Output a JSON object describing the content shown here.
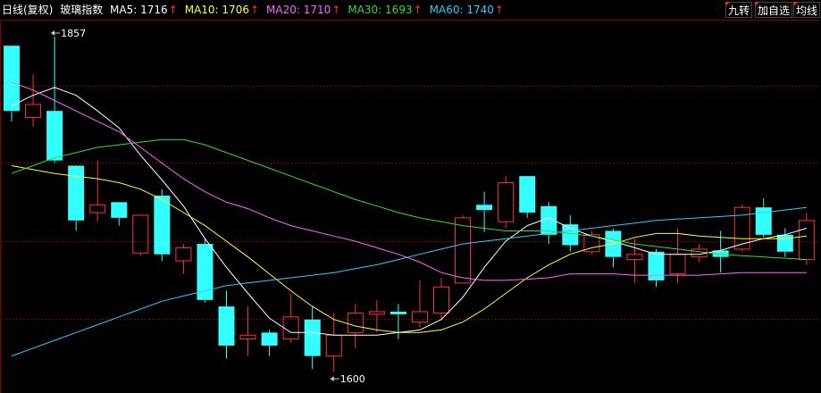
{
  "header": {
    "period": "日线(复权)",
    "name": "玻璃指数",
    "ma": [
      {
        "label": "MA5:",
        "value": "1716",
        "color": "#ffffff"
      },
      {
        "label": "MA10:",
        "value": "1706",
        "color": "#ffff33"
      },
      {
        "label": "MA20:",
        "value": "1710",
        "color": "#ff66ff"
      },
      {
        "label": "MA30:",
        "value": "1693",
        "color": "#33dd33"
      },
      {
        "label": "MA60:",
        "value": "1740",
        "color": "#33ccff"
      }
    ],
    "arrow": "↑"
  },
  "buttons": {
    "nine": "九转",
    "watch": "加自选",
    "avg": "均线"
  },
  "colors": {
    "up": "#ff3030",
    "down": "#33ffff",
    "grid": "#800000",
    "bg": "#000000"
  },
  "chart_data": {
    "type": "candlestick",
    "ylim": [
      1585,
      1870
    ],
    "annotations": {
      "high_label": "1857",
      "low_label": "1600"
    },
    "candles": [
      {
        "o": 1850,
        "c": 1800,
        "h": 1850,
        "l": 1792
      },
      {
        "o": 1795,
        "c": 1805,
        "h": 1828,
        "l": 1788
      },
      {
        "o": 1800,
        "c": 1762,
        "h": 1857,
        "l": 1760
      },
      {
        "o": 1758,
        "c": 1716,
        "h": 1758,
        "l": 1708
      },
      {
        "o": 1722,
        "c": 1728,
        "h": 1762,
        "l": 1715
      },
      {
        "o": 1730,
        "c": 1718,
        "h": 1730,
        "l": 1712
      },
      {
        "o": 1691,
        "c": 1720,
        "h": 1720,
        "l": 1689
      },
      {
        "o": 1735,
        "c": 1690,
        "h": 1740,
        "l": 1685
      },
      {
        "o": 1685,
        "c": 1695,
        "h": 1698,
        "l": 1675
      },
      {
        "o": 1698,
        "c": 1655,
        "h": 1702,
        "l": 1653
      },
      {
        "o": 1650,
        "c": 1620,
        "h": 1662,
        "l": 1610
      },
      {
        "o": 1625,
        "c": 1628,
        "h": 1650,
        "l": 1612
      },
      {
        "o": 1630,
        "c": 1620,
        "h": 1632,
        "l": 1612
      },
      {
        "o": 1625,
        "c": 1642,
        "h": 1660,
        "l": 1622
      },
      {
        "o": 1640,
        "c": 1612,
        "h": 1650,
        "l": 1602
      },
      {
        "o": 1612,
        "c": 1628,
        "h": 1645,
        "l": 1600
      },
      {
        "o": 1630,
        "c": 1645,
        "h": 1652,
        "l": 1618
      },
      {
        "o": 1644,
        "c": 1646,
        "h": 1655,
        "l": 1630
      },
      {
        "o": 1646,
        "c": 1644,
        "h": 1652,
        "l": 1625
      },
      {
        "o": 1638,
        "c": 1646,
        "h": 1670,
        "l": 1634
      },
      {
        "o": 1645,
        "c": 1665,
        "h": 1672,
        "l": 1640
      },
      {
        "o": 1668,
        "c": 1718,
        "h": 1720,
        "l": 1668
      },
      {
        "o": 1728,
        "c": 1724,
        "h": 1738,
        "l": 1707
      },
      {
        "o": 1715,
        "c": 1745,
        "h": 1750,
        "l": 1710
      },
      {
        "o": 1750,
        "c": 1722,
        "h": 1750,
        "l": 1718
      },
      {
        "o": 1727,
        "c": 1705,
        "h": 1730,
        "l": 1698
      },
      {
        "o": 1713,
        "c": 1697,
        "h": 1720,
        "l": 1692
      },
      {
        "o": 1692,
        "c": 1705,
        "h": 1708,
        "l": 1690
      },
      {
        "o": 1708,
        "c": 1688,
        "h": 1710,
        "l": 1680
      },
      {
        "o": 1686,
        "c": 1690,
        "h": 1702,
        "l": 1668
      },
      {
        "o": 1692,
        "c": 1670,
        "h": 1694,
        "l": 1665
      },
      {
        "o": 1675,
        "c": 1690,
        "h": 1710,
        "l": 1668
      },
      {
        "o": 1688,
        "c": 1694,
        "h": 1698,
        "l": 1684
      },
      {
        "o": 1693,
        "c": 1688,
        "h": 1708,
        "l": 1676
      },
      {
        "o": 1694,
        "c": 1726,
        "h": 1728,
        "l": 1692
      },
      {
        "o": 1726,
        "c": 1705,
        "h": 1733,
        "l": 1703
      },
      {
        "o": 1705,
        "c": 1692,
        "h": 1710,
        "l": 1688
      },
      {
        "o": 1686,
        "c": 1716,
        "h": 1722,
        "l": 1682
      }
    ],
    "moving_averages": [
      {
        "name": "MA5",
        "color": "#ffffff",
        "values": [
          1804,
          1812,
          1818,
          1812,
          1800,
          1787,
          1766,
          1747,
          1727,
          1702,
          1680,
          1660,
          1641,
          1630,
          1630,
          1628,
          1628,
          1628,
          1630,
          1632,
          1640,
          1657,
          1680,
          1700,
          1712,
          1718,
          1710,
          1704,
          1700,
          1695,
          1690,
          1690,
          1690,
          1693,
          1698,
          1702,
          1705,
          1710
        ]
      },
      {
        "name": "MA10",
        "color": "#ffff33",
        "values": [
          1758,
          1755,
          1752,
          1750,
          1748,
          1745,
          1740,
          1732,
          1722,
          1712,
          1700,
          1688,
          1675,
          1662,
          1650,
          1640,
          1635,
          1632,
          1630,
          1630,
          1632,
          1638,
          1648,
          1660,
          1672,
          1682,
          1690,
          1695,
          1698,
          1703,
          1706,
          1706,
          1704,
          1703,
          1702,
          1702,
          1702,
          1704
        ]
      },
      {
        "name": "MA20",
        "color": "#ff66ff",
        "values": [
          1822,
          1816,
          1808,
          1800,
          1792,
          1784,
          1772,
          1760,
          1748,
          1738,
          1730,
          1725,
          1718,
          1712,
          1708,
          1704,
          1700,
          1695,
          1690,
          1684,
          1676,
          1672,
          1670,
          1670,
          1671,
          1672,
          1675,
          1675,
          1675,
          1674,
          1674,
          1674,
          1674,
          1675,
          1676,
          1676,
          1676,
          1676
        ]
      },
      {
        "name": "MA30",
        "color": "#33dd33",
        "values": [
          1752,
          1758,
          1764,
          1768,
          1772,
          1774,
          1776,
          1778,
          1778,
          1774,
          1768,
          1762,
          1756,
          1750,
          1744,
          1738,
          1732,
          1727,
          1722,
          1718,
          1715,
          1712,
          1710,
          1708,
          1708,
          1708,
          1706,
          1704,
          1701,
          1698,
          1696,
          1694,
          1692,
          1690,
          1689,
          1688,
          1687,
          1686
        ]
      },
      {
        "name": "MA60",
        "color": "#33ccff",
        "values": [
          1612,
          1618,
          1624,
          1630,
          1636,
          1642,
          1648,
          1654,
          1658,
          1662,
          1666,
          1668,
          1670,
          1672,
          1674,
          1676,
          1679,
          1682,
          1686,
          1690,
          1694,
          1698,
          1700,
          1702,
          1704,
          1706,
          1708,
          1710,
          1712,
          1714,
          1716,
          1717,
          1718,
          1719,
          1720,
          1722,
          1724,
          1726
        ]
      }
    ]
  }
}
